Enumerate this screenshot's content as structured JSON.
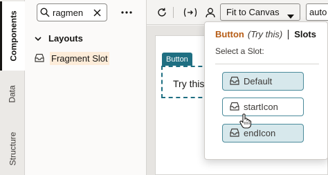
{
  "sidebar_tabs": [
    {
      "label": "Components"
    },
    {
      "label": "Data"
    },
    {
      "label": "Structure"
    }
  ],
  "components_panel": {
    "search": {
      "value": "ragmen"
    },
    "section_label": "Layouts",
    "items": [
      {
        "label": "Fragment Slot"
      }
    ]
  },
  "toolbar": {
    "fit_select": "Fit to Canvas",
    "size_value": "auto"
  },
  "canvas": {
    "component_badge": "Button",
    "component_text": "Try this"
  },
  "slot_popup": {
    "component_name": "Button",
    "component_sub": "(Try this)",
    "slots_title": "Slots",
    "prompt": "Select a Slot:",
    "slots": [
      {
        "label": "Default",
        "selected": true
      },
      {
        "label": "startIcon",
        "selected": false
      },
      {
        "label": "endIcon",
        "selected": true
      }
    ]
  },
  "colors": {
    "accent_teal": "#1f6f82",
    "slot_fill": "#d7e8ec",
    "title_orange": "#b65c15"
  }
}
